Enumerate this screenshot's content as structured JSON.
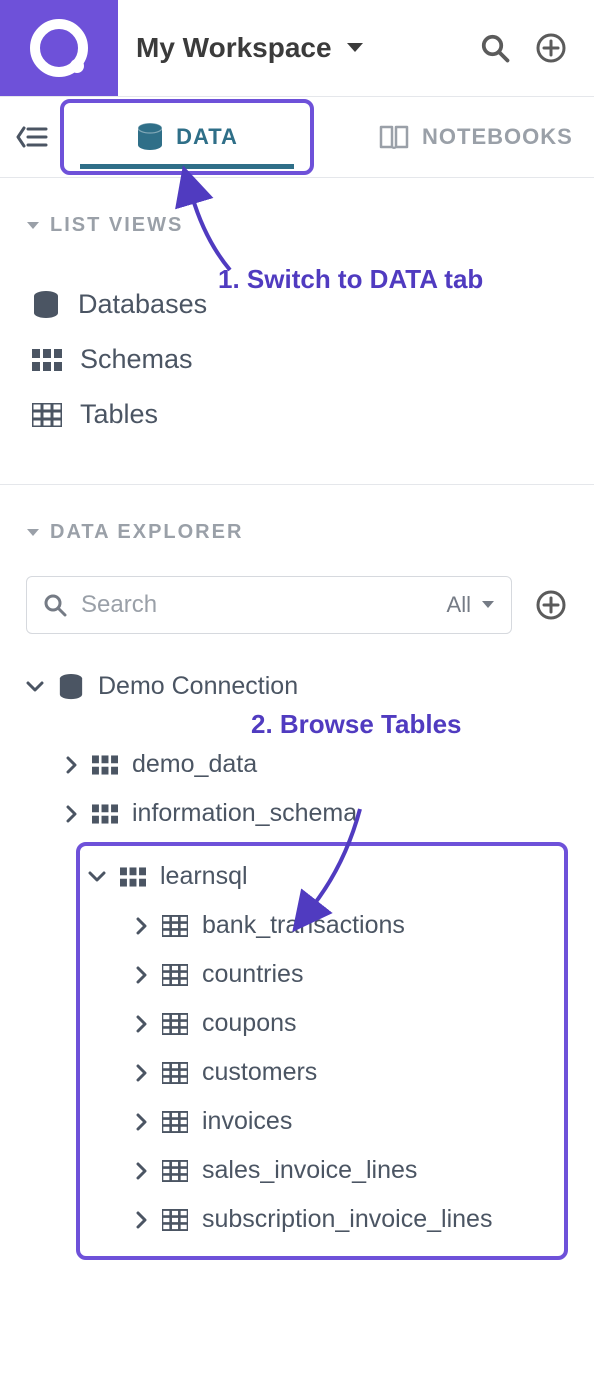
{
  "header": {
    "workspace_label": "My Workspace"
  },
  "tabs": {
    "data": "DATA",
    "notebooks": "NOTEBOOKS"
  },
  "list_views": {
    "title": "LIST VIEWS",
    "items": [
      "Databases",
      "Schemas",
      "Tables"
    ]
  },
  "data_explorer": {
    "title": "DATA EXPLORER",
    "search_placeholder": "Search",
    "filter_label": "All",
    "connection": "Demo Connection",
    "schemas": [
      {
        "name": "demo_data",
        "expanded": false
      },
      {
        "name": "information_schema",
        "expanded": false
      },
      {
        "name": "learnsql",
        "expanded": true
      }
    ],
    "learnsql_tables": [
      "bank_transactions",
      "countries",
      "coupons",
      "customers",
      "invoices",
      "sales_invoice_lines",
      "subscription_invoice_lines"
    ]
  },
  "annotations": {
    "step1": "1. Switch to DATA tab",
    "step2": "2. Browse Tables"
  }
}
